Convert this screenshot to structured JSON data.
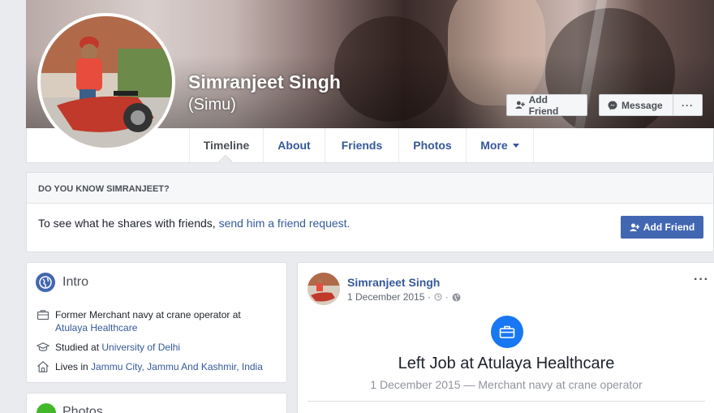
{
  "profile": {
    "name": "Simranjeet Singh",
    "alternate_name": "(Simu)"
  },
  "cover_actions": {
    "add_friend_label": "Add Friend",
    "message_label": "Message",
    "more_label": "···"
  },
  "nav": {
    "tabs": [
      {
        "label": "Timeline",
        "active": true
      },
      {
        "label": "About"
      },
      {
        "label": "Friends"
      },
      {
        "label": "Photos"
      },
      {
        "label": "More"
      }
    ]
  },
  "know_panel": {
    "heading": "DO YOU KNOW SIMRANJEET?",
    "text": "To see what he shares with friends, ",
    "link": "send him a friend request.",
    "button_label": "Add Friend"
  },
  "intro": {
    "title": "Intro",
    "work_prefix": "Former Merchant navy at crane operator at",
    "work_link": "Atulaya Healthcare",
    "study_prefix": "Studied at ",
    "study_link": "University of Delhi",
    "live_prefix": "Lives in ",
    "live_link": "Jammu City, Jammu And Kashmir, India"
  },
  "photos_card": {
    "title": "Photos"
  },
  "post": {
    "author": "Simranjeet Singh",
    "date": "1 December 2015 · ",
    "menu_label": "···",
    "event_title": "Left Job at Atulaya Healthcare",
    "event_subtitle": "1 December 2015 — Merchant navy at crane operator"
  },
  "colors": {
    "brand_blue": "#4267b2",
    "link_blue": "#365899",
    "page_bg": "#e9ebee"
  },
  "icons": [
    "add-friend-icon",
    "messenger-icon",
    "globe-icon",
    "briefcase-icon",
    "graduation-cap-icon",
    "home-icon",
    "clock-icon",
    "public-globe-icon",
    "caret-down-icon"
  ]
}
